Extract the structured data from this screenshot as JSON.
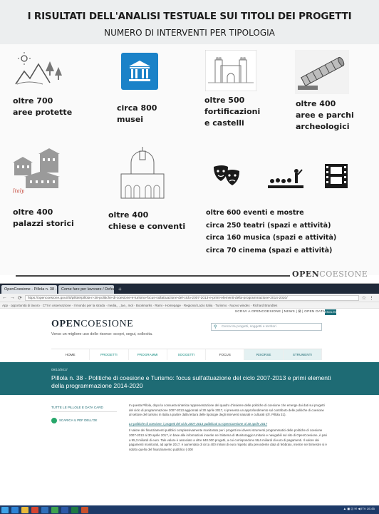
{
  "slide": {
    "title": "I RISULTATI DELL'ANALISI TESTUALE SUI TITOLI DEI PROGETTI",
    "subtitle": "NUMERO DI INTERVENTI PER TIPOLOGIA",
    "items": [
      {
        "line1": "oltre 700",
        "line2": "aree protette"
      },
      {
        "line1": "circa 800",
        "line2": "musei"
      },
      {
        "line1": "oltre 500",
        "line2": "fortificazioni",
        "line3": "e castelli"
      },
      {
        "line1": "oltre 400",
        "line2": "aree e parchi",
        "line3": "archeologici"
      },
      {
        "line1": "oltre 400",
        "line2": "palazzi storici"
      },
      {
        "line1": "oltre 400",
        "line2": "chiese e conventi"
      }
    ],
    "events": [
      "oltre 600 eventi e mostre",
      "circa 250 teatri (spazi e attività)",
      "circa 160 musica (spazi e attività)",
      "circa 70 cinema (spazi e attività)"
    ],
    "logo_bold": "OPEN",
    "logo_light": "COESIONE"
  },
  "browser": {
    "tabs": [
      "OpenCoesione - Pillola n. 38 - ×",
      "Come fare per lavorare / Defeat - ×"
    ],
    "new_tab": "+",
    "url": "https://opencoesione.gov.it/it/pillole/pillola-n-38-politiche-di-coesione-e-turismo-focus-sullattuazione-del-ciclo-2007-2013-e-primi-elementi-della-programmazione-2014-2020/",
    "bookmarks": "App  ·  opportunità di lavoro  ·  CTI in osservazione  ·  Il mondo per la strada  ·  media_ _tue_ mol  ·  Bookmarks  ·  Rami - Homepage  ·  Regional Lazio Italia  ·  Turismo  ·  Nuovo windex  ·  Richard Brandtes"
  },
  "site": {
    "top_links": "SCRIVI A OPENCOESIONE  |  NEWS  |  ⊠  |  OPEN DATA",
    "lang": "ENGLISH",
    "brand_bold": "OPEN",
    "brand_light": "COESIONE",
    "tagline": "Verso un migliore uso delle risorse: scopri, segui, sollecita.",
    "search_placeholder": "Cerca tra progetti, soggetti e territori",
    "menu": [
      "HOME",
      "PROGETTI",
      "PROGRAMMI",
      "SOGGETTI",
      "FOCUS",
      "RISORSE",
      "STRUMENTI"
    ],
    "date": "09/10/2017",
    "title": "Pillola n. 38 - Politiche di coesione e Turismo: focus sull'attuazione del ciclo 2007-2013 e primi elementi della programmazione 2014-2020",
    "sidebar_link": "TUTTE LE PILLOLE E DATA CARD",
    "share": "SCARICA IL PDF DELL'OE",
    "paragraph1": "In questa Pillola, dopo la consueta sintetica rappresentazione del quadro d'insieme delle politiche di coesione che emerge dai dati sui progetti del ciclo di programmazione 2007-2013 aggiornati al 30 aprile 2017, si presenta un approfondimento sul contributo delle politiche di coesione al settore del turismo in Italia a partire dalla lettura delle tipologie degli interventi naturali e culturali (cfr. Pillola 31).",
    "section_title": "Le politiche di coesione: i progetti del ciclo 2007-2013 pubblicati su OpenCoesione al 30 aprile 2017",
    "paragraph2": "Il valore dei finanziamenti pubblici complessivamente monitorato per i progetti nei diversi strumenti programmatici delle politiche di coesione 2007-2013 al 30 aprile 2017, in base alle informazioni inserite nel Sistema di Monitoraggio Unitario e navigabili sul sito di OpenCoesione, è pari a 95,3 miliardi di euro. Tale valore è associato a oltre 940.000 progetti, a cui corrispondono 59,6 miliardi di euro di pagamenti. Il valore dei pagamenti monitorati, ad aprile 2017, è aumentato di circa 400 milioni di euro rispetto alla precedente data di febbraio, mentre nel trimestre si è ridotto quello del finanziamento pubblico (-300",
    "tray": "▲  ◼  ⊡  ✉  ◀  ITA  16:45"
  },
  "colors": {
    "teal": "#1e6b74",
    "accent_green": "#0d8a7e",
    "taskbar": "#1d3a68"
  }
}
